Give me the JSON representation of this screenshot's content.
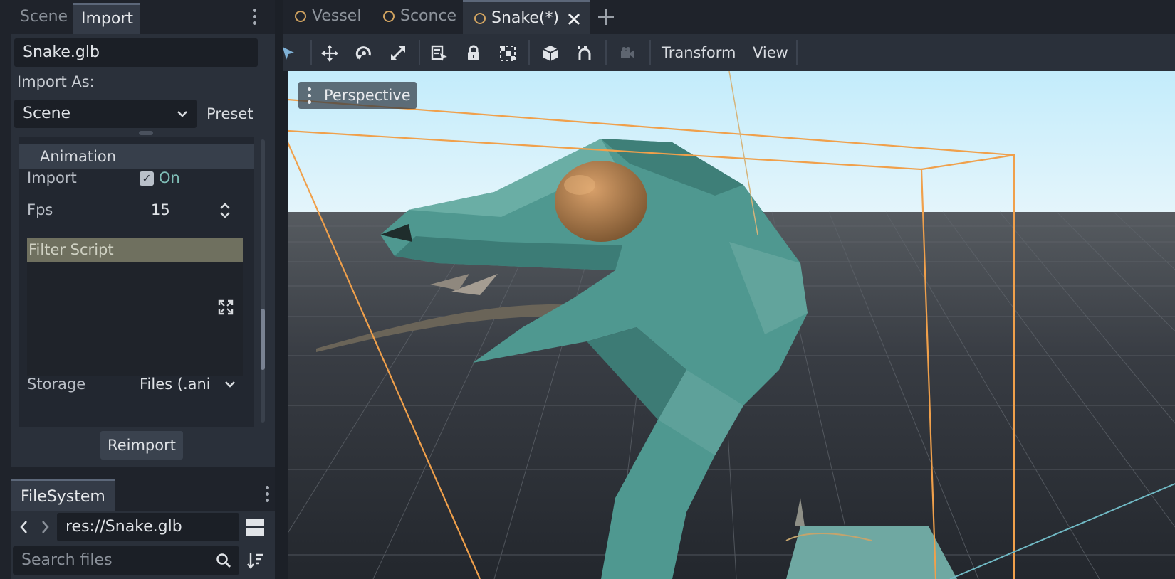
{
  "left_dock": {
    "tabs": [
      {
        "label": "Scene"
      },
      {
        "label": "Import"
      }
    ],
    "active_tab": "Import",
    "import": {
      "file_name": "Snake.glb",
      "import_as_label": "Import As:",
      "import_as_value": "Scene",
      "preset_label": "Preset",
      "section": "Animation",
      "properties": {
        "import_label": "Import",
        "import_value": "On",
        "fps_label": "Fps",
        "fps_value": "15",
        "filter_script_label": "Filter Script",
        "storage_label": "Storage",
        "storage_value": "Files (.ani"
      },
      "reimport_label": "Reimport"
    }
  },
  "filesystem": {
    "tab_label": "FileSystem",
    "path": "res://Snake.glb",
    "search_placeholder": "Search files"
  },
  "editor": {
    "scene_tabs": [
      {
        "label": "Vessel",
        "active": false
      },
      {
        "label": "Sconce",
        "active": false
      },
      {
        "label": "Snake(*)",
        "active": true
      }
    ],
    "toolbar": {
      "tools": [
        "select-icon",
        "move-icon",
        "rotate-icon",
        "scale-icon",
        "list-select-icon",
        "lock-icon",
        "group-icon",
        "local-space-icon",
        "snap-icon",
        "camera-icon"
      ],
      "menus": [
        "Transform",
        "View"
      ]
    },
    "viewport": {
      "mode_label": "Perspective"
    }
  },
  "colors": {
    "accent_orange": "#f0a04b",
    "snake_green": "#4f9890",
    "eye_brown": "#b47f4c",
    "sky": "#c8ecfb"
  }
}
